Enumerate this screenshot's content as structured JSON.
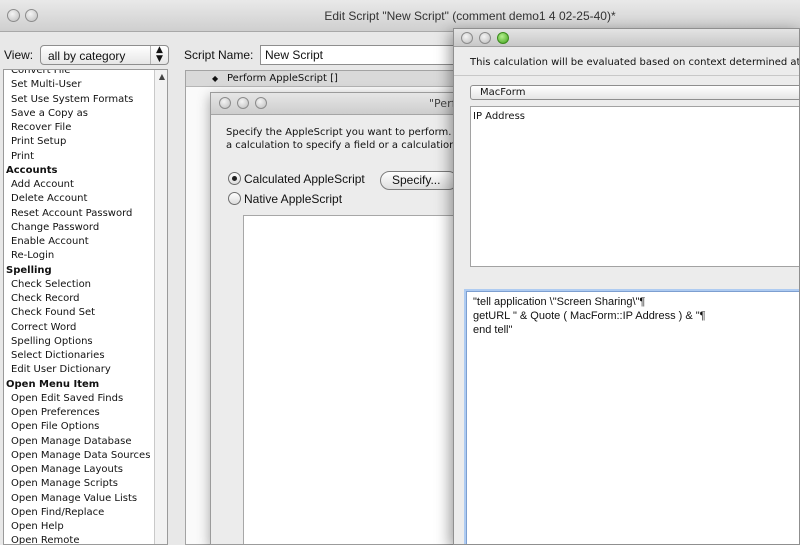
{
  "main_window": {
    "title": "Edit Script \"New Script\" (comment demo1 4 02-25-40)*",
    "view_label": "View:",
    "view_value": "all by category",
    "script_name_label": "Script Name:",
    "script_name_value": "New Script",
    "script_step": "Perform AppleScript []"
  },
  "steps": [
    {
      "label": "Convert File",
      "category": false
    },
    {
      "label": "Set Multi-User",
      "category": false
    },
    {
      "label": "Set Use System Formats",
      "category": false
    },
    {
      "label": "Save a Copy as",
      "category": false
    },
    {
      "label": "Recover File",
      "category": false
    },
    {
      "label": "Print Setup",
      "category": false
    },
    {
      "label": "Print",
      "category": false
    },
    {
      "label": "Accounts",
      "category": true
    },
    {
      "label": "Add Account",
      "category": false
    },
    {
      "label": "Delete Account",
      "category": false
    },
    {
      "label": "Reset Account Password",
      "category": false
    },
    {
      "label": "Change Password",
      "category": false
    },
    {
      "label": "Enable Account",
      "category": false
    },
    {
      "label": "Re-Login",
      "category": false
    },
    {
      "label": "Spelling",
      "category": true
    },
    {
      "label": "Check Selection",
      "category": false
    },
    {
      "label": "Check Record",
      "category": false
    },
    {
      "label": "Check Found Set",
      "category": false
    },
    {
      "label": "Correct Word",
      "category": false
    },
    {
      "label": "Spelling Options",
      "category": false
    },
    {
      "label": "Select Dictionaries",
      "category": false
    },
    {
      "label": "Edit User Dictionary",
      "category": false
    },
    {
      "label": "Open Menu Item",
      "category": true
    },
    {
      "label": "Open Edit Saved Finds",
      "category": false
    },
    {
      "label": "Open Preferences",
      "category": false
    },
    {
      "label": "Open File Options",
      "category": false
    },
    {
      "label": "Open Manage Database",
      "category": false
    },
    {
      "label": "Open Manage Data Sources",
      "category": false
    },
    {
      "label": "Open Manage Layouts",
      "category": false
    },
    {
      "label": "Open Manage Scripts",
      "category": false
    },
    {
      "label": "Open Manage Value Lists",
      "category": false
    },
    {
      "label": "Open Find/Replace",
      "category": false
    },
    {
      "label": "Open Help",
      "category": false
    },
    {
      "label": "Open Remote",
      "category": false
    }
  ],
  "perform_dialog": {
    "title": "\"Perf",
    "instruction_line1": "Specify the AppleScript you want to perform. Yo",
    "instruction_line2": "a calculation to specify a field or a calculation, v",
    "option_calculated": "Calculated AppleScript",
    "option_native": "Native AppleScript",
    "specify_button": "Specify..."
  },
  "calc_dialog": {
    "context_text": "This calculation will be evaluated based on context determined at run",
    "table_value": "MacForm",
    "fields": [
      "IP Address"
    ],
    "formula": "\"tell application \\\"Screen Sharing\\\"¶\ngetURL \" & Quote ( MacForm::IP Address ) & \"¶\nend tell\""
  },
  "icons": {
    "select_arrows": "up-down-arrows-icon",
    "step_handle": "drag-handle-icon",
    "scroll_up": "scroll-up-arrow-icon"
  }
}
